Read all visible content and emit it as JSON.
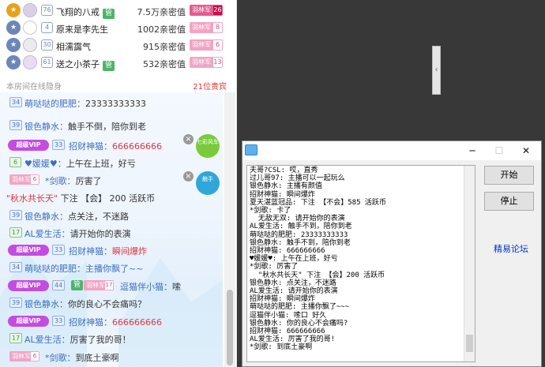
{
  "ranking": [
    {
      "medal": "gold",
      "level": "76",
      "name": "飞翔的八戒",
      "badge": "管",
      "value": "7.5万亲密值",
      "fan": "羽林军",
      "fan_level": "26",
      "fan_hi": true
    },
    {
      "medal": "silver",
      "level": "4",
      "name": "原来是李先生",
      "badge": "",
      "value": "1002亲密值",
      "fan": "羽林军",
      "fan_level": "8",
      "fan_hi": false
    },
    {
      "medal": "silver",
      "level": "30",
      "name": "相濡靄气",
      "badge": "",
      "value": "915亲密值",
      "fan": "羽林军",
      "fan_level": "6",
      "fan_hi": false
    },
    {
      "medal": "silver",
      "level": "61",
      "name": "送之小茶子",
      "badge": "管",
      "value": "532亲密值",
      "fan": "羽林军",
      "fan_level": "13",
      "fan_hi": false
    }
  ],
  "room_hidden_text": "本房间在线隐身",
  "online_count": "21位贵宾",
  "chat": {
    "r1": {
      "level": "34",
      "name": "萌哒哒的肥肥：",
      "msg": "23333333333"
    },
    "r2": {
      "level": "39",
      "name": "银色静水：",
      "msg": "触手不倒，陪你到老"
    },
    "r3": {
      "badge": "超级VIP",
      "level": "33",
      "name": "招财神猫：",
      "msg": "666666666"
    },
    "r4": {
      "level": "6",
      "name": "♥媛媛♥：",
      "msg": "上午在上班，好亏"
    },
    "r5": {
      "fan": "羽林军",
      "fan_level": "6",
      "name": "*剑歌：",
      "msg": "厉害了"
    },
    "r6": {
      "quote": "\"秋水共长天\"",
      "mid": "下注 【会】 200 活跃币"
    },
    "r7": {
      "level": "39",
      "name": "银色静水：",
      "msg": "点关注，不迷路"
    },
    "r8": {
      "level": "17",
      "name": "AL爱生活：",
      "msg": "请开始你的表演"
    },
    "r9": {
      "badge": "超级VIP",
      "level": "33",
      "name": "招财神猫：",
      "msg": "瞬间爆炸"
    },
    "r10": {
      "level": "34",
      "name": "萌哒哒的肥肥：",
      "msg": "主播你飘了~~"
    },
    "r11": {
      "badge": "超级VIP",
      "level": "44",
      "tag": "管",
      "fan": "羽林军",
      "fan_level": "17",
      "name": "逗猫伴小猫：",
      "msg": "嗦"
    },
    "r12": {
      "level": "39",
      "name": "银色静水：",
      "msg": "你的良心不会痛吗？"
    },
    "r13": {
      "badge": "超级VIP",
      "level": "33",
      "name": "招财神猫：",
      "msg": "666666666"
    },
    "r14": {
      "level": "17",
      "name": "AL爱生活：",
      "msg": "厉害了我的哥！"
    },
    "r15": {
      "fan": "羽林军",
      "fan_level": "6",
      "name": "*剑歌：",
      "msg": "到底土豪啊"
    }
  },
  "gifts": {
    "g1": "七彩风车",
    "g2": "触手"
  },
  "window": {
    "close_glyph": "✕",
    "max_glyph": "☐",
    "min_glyph": "─",
    "log_text": "夫哥?CSL: 哎，直秀\n过儿哥97: 主播可以一起玩么\n银色静水: 主播有颜值\n招财神猫: 瞬间爆炸\n夏天湛蓝冠品: 下注 【不会】585 活跃币\n*剑歌: 卡了\n  无敌无双: 请开始你的表演\nAL爱生活: 触手不到，陪你到老\n萌哒哒的肥肥: 23333333333\n银色静水: 触手不到，陪你到老\n招财神猫: 666666666\n♥媛媛♥: 上午在上班，好亏\n*剑歌: 厉害了\n  \"秋水共长天\" 下注 【会】200 活跃币\n银色静水: 点关注，不迷路\nAL爱生活: 请开始你的表演\n招财神猫: 瞬间爆炸\n萌哒哒的肥肥: 主播你飘了~~~\n逗猫伴小猫: 嗦口 好久\n银色静水: 你的良心不会痛吗?\n招财神猫: 666666666\nAL爱生活: 厉害了我的哥!\n*剑歌: 到底土豪啊",
    "start_label": "开始",
    "stop_label": "停止",
    "link_label": "精易论坛"
  }
}
